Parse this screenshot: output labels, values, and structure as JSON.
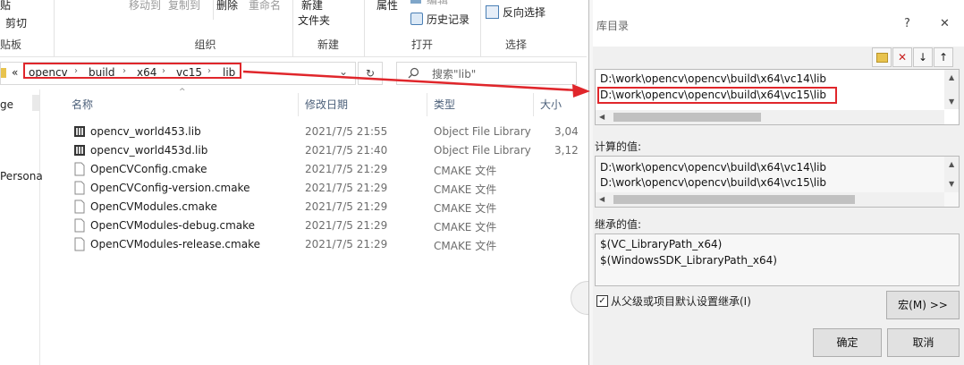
{
  "ribbon": {
    "items": {
      "clip_top": "贴",
      "cut": "剪切",
      "clipboard_group": "贴板",
      "move_to": "移动到",
      "copy_to": "复制到",
      "delete": "删除",
      "rename": "重命名",
      "organize_group": "组织",
      "new_top": "新建",
      "new_folder": "文件夹",
      "new_group": "新建",
      "properties": "属性",
      "edit_partial": "编辑",
      "history": "历史记录",
      "open_group": "打开",
      "invert_select": "反向选择",
      "select_group": "选择"
    }
  },
  "address": {
    "overflow": "«",
    "crumbs": [
      "opencv",
      "build",
      "x64",
      "vc15",
      "lib"
    ],
    "search_placeholder": "搜索\"lib\""
  },
  "nav": {
    "items": [
      "ge",
      "Persona"
    ]
  },
  "columns": {
    "name": "名称",
    "date": "修改日期",
    "type": "类型",
    "size": "大小"
  },
  "files": [
    {
      "name": "opencv_world453.lib",
      "date": "2021/7/5 21:55",
      "type": "Object File Library",
      "size": "3,04",
      "icon": "lib-file-icon"
    },
    {
      "name": "opencv_world453d.lib",
      "date": "2021/7/5 21:40",
      "type": "Object File Library",
      "size": "3,12",
      "icon": "lib-file-icon"
    },
    {
      "name": "OpenCVConfig.cmake",
      "date": "2021/7/5 21:29",
      "type": "CMAKE 文件",
      "size": "",
      "icon": "blank-file-icon"
    },
    {
      "name": "OpenCVConfig-version.cmake",
      "date": "2021/7/5 21:29",
      "type": "CMAKE 文件",
      "size": "",
      "icon": "blank-file-icon"
    },
    {
      "name": "OpenCVModules.cmake",
      "date": "2021/7/5 21:29",
      "type": "CMAKE 文件",
      "size": "",
      "icon": "blank-file-icon"
    },
    {
      "name": "OpenCVModules-debug.cmake",
      "date": "2021/7/5 21:29",
      "type": "CMAKE 文件",
      "size": "",
      "icon": "blank-file-icon"
    },
    {
      "name": "OpenCVModules-release.cmake",
      "date": "2021/7/5 21:29",
      "type": "CMAKE 文件",
      "size": "",
      "icon": "blank-file-icon"
    }
  ],
  "dialog": {
    "title": "库目录",
    "help": "?",
    "close": "✕",
    "entries": [
      "D:\\work\\opencv\\opencv\\build\\x64\\vc14\\lib",
      "D:\\work\\opencv\\opencv\\build\\x64\\vc15\\lib"
    ],
    "computed_label": "计算的值:",
    "computed": [
      "D:\\work\\opencv\\opencv\\build\\x64\\vc14\\lib",
      "D:\\work\\opencv\\opencv\\build\\x64\\vc15\\lib"
    ],
    "inherited_label": "继承的值:",
    "inherited": [
      "$(VC_LibraryPath_x64)",
      "$(WindowsSDK_LibraryPath_x64)"
    ],
    "inherit_checkbox": "从父级或项目默认设置继承(I)",
    "macro_button": "宏(M) >>",
    "ok": "确定",
    "cancel": "取消"
  },
  "colors": {
    "highlight": "#e0262b",
    "dialog_bg": "#f0f0f0",
    "header_text": "#4c607a"
  }
}
